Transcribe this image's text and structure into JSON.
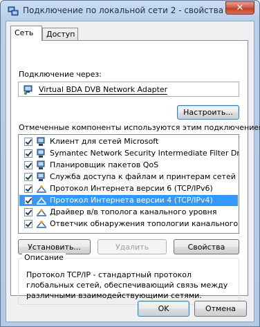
{
  "window": {
    "title": "Подключение по локальной сети 2 - свойства",
    "close_label": "✕"
  },
  "tabs": [
    {
      "label": "Сеть",
      "active": true
    },
    {
      "label": "Доступ",
      "active": false
    }
  ],
  "connect_using_label": "Подключение через:",
  "adapter_name": "Virtual BDA DVB Network Adapter",
  "configure_button": "Настроить...",
  "components_label": "Отмеченные компоненты используются этим подключением:",
  "components": [
    {
      "label": "Клиент для сетей Microsoft",
      "checked": true,
      "icon": "network-client-icon"
    },
    {
      "label": "Symantec Network Security Intermediate Filter Driver",
      "checked": true,
      "icon": "network-client-icon"
    },
    {
      "label": "Планировщик пакетов QoS",
      "checked": true,
      "icon": "network-client-icon"
    },
    {
      "label": "Служба доступа к файлам и принтерам сетей Micro...",
      "checked": true,
      "icon": "network-client-icon"
    },
    {
      "label": "Протокол Интернета версии 6 (TCP/IPv6)",
      "checked": true,
      "icon": "protocol-icon"
    },
    {
      "label": "Протокол Интернета версии 4 (TCP/IPv4)",
      "checked": true,
      "icon": "protocol-icon",
      "selected": true
    },
    {
      "label": "Драйвер в/в тополога канального уровня",
      "checked": true,
      "icon": "protocol-icon"
    },
    {
      "label": "Ответчик обнаружения топологии канального уровня",
      "checked": true,
      "icon": "protocol-icon"
    }
  ],
  "install_button": "Установить...",
  "uninstall_button": "Удалить",
  "properties_button": "Свойства",
  "description_title": "Описание",
  "description_text": "Протокол TCP/IP - стандартный протокол глобальных сетей, обеспечивающий связь между различными взаимодействующими сетями.",
  "ok_button": "OK",
  "cancel_button": "Отмена",
  "colors": {
    "selection": "#3399ff",
    "frame": "#b8cfea",
    "close": "#c23e22"
  }
}
